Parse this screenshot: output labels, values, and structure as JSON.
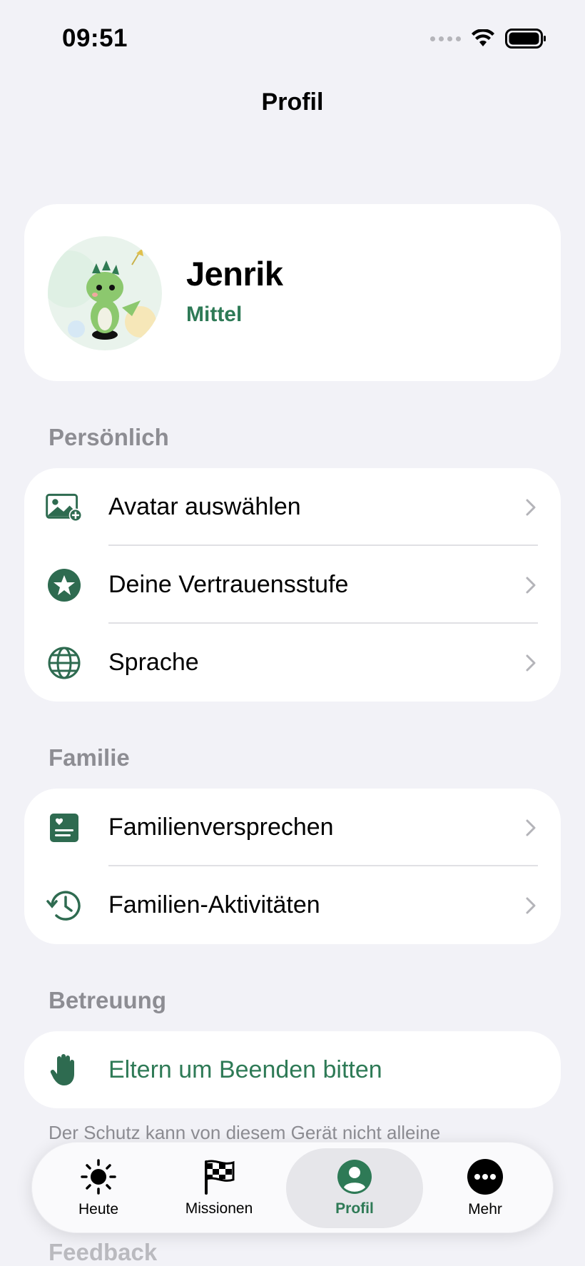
{
  "status_bar": {
    "time": "09:51"
  },
  "nav": {
    "title": "Profil"
  },
  "profile": {
    "name": "Jenrik",
    "level": "Mittel"
  },
  "sections": {
    "personal": {
      "title": "Persönlich",
      "items": [
        {
          "label": "Avatar auswählen",
          "icon": "image-plus-icon"
        },
        {
          "label": "Deine Vertrauensstufe",
          "icon": "star-circle-icon"
        },
        {
          "label": "Sprache",
          "icon": "globe-icon"
        }
      ]
    },
    "family": {
      "title": "Familie",
      "items": [
        {
          "label": "Familienversprechen",
          "icon": "heart-document-icon"
        },
        {
          "label": "Familien-Aktivitäten",
          "icon": "history-icon"
        }
      ]
    },
    "care": {
      "title": "Betreuung",
      "action": {
        "label": "Eltern um Beenden bitten",
        "icon": "hand-icon"
      },
      "footnote": "Der Schutz kann von diesem Gerät nicht alleine"
    },
    "feedback": {
      "title": "Feedback"
    }
  },
  "tab_bar": {
    "tabs": [
      {
        "label": "Heute",
        "icon": "sun-icon"
      },
      {
        "label": "Missionen",
        "icon": "checkered-flag-icon"
      },
      {
        "label": "Profil",
        "icon": "person-circle-icon",
        "active": true
      },
      {
        "label": "Mehr",
        "icon": "ellipsis-circle-icon"
      }
    ]
  },
  "colors": {
    "accent": "#2e7a56",
    "background": "#f2f2f7",
    "secondary_text": "#8d8d93"
  }
}
